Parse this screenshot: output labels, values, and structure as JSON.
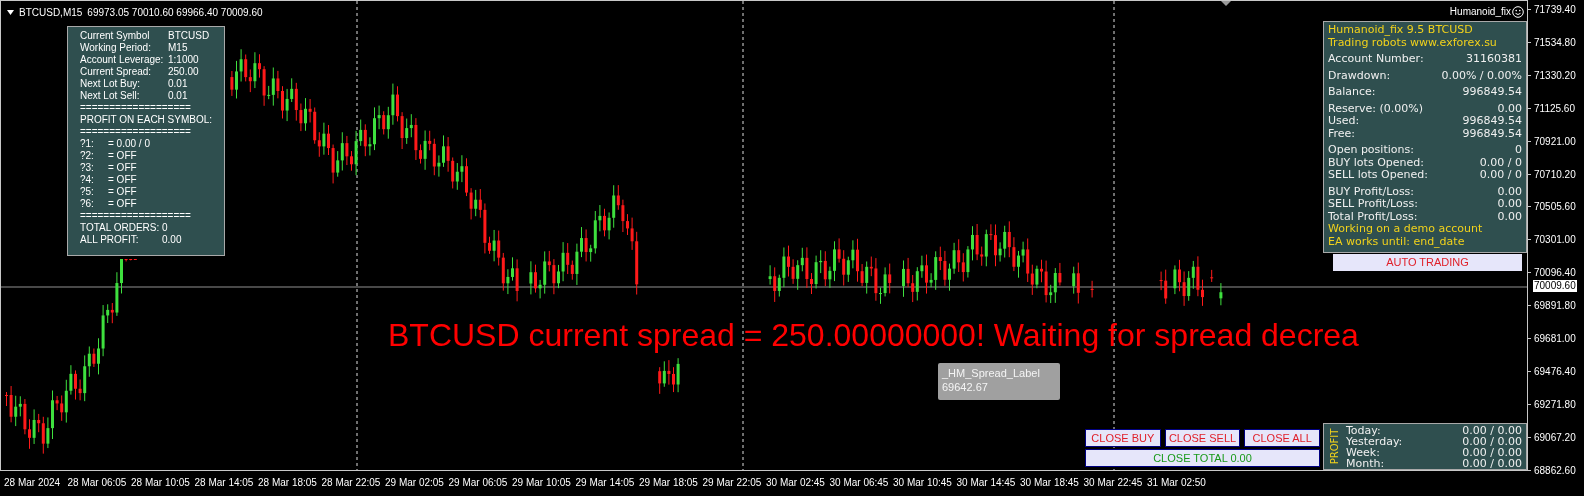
{
  "chart_header": {
    "symbol": "BTCUSD,M15",
    "prices": [
      "69973.05",
      "70010.60",
      "69966.40",
      "70009.60"
    ]
  },
  "expert_label": "Humanoid_fix",
  "info_panel": {
    "rows": [
      {
        "kind": "pair",
        "label": "Current Symbol",
        "value": "BTCUSD"
      },
      {
        "kind": "pair",
        "label": "Working Period:",
        "value": "M15"
      },
      {
        "kind": "pair",
        "label": "Account Leverage:",
        "value": "1:1000"
      },
      {
        "kind": "pair",
        "label": "Current Spread:",
        "value": "250.00"
      },
      {
        "kind": "pair",
        "label": "Next Lot Buy:",
        "value": "0.01"
      },
      {
        "kind": "pair",
        "label": "Next Lot Sell:",
        "value": "0.01"
      },
      {
        "kind": "text",
        "text": "==================="
      },
      {
        "kind": "text",
        "text": "PROFIT ON EACH SYMBOL:"
      },
      {
        "kind": "text",
        "text": "==================="
      },
      {
        "kind": "symbol",
        "label": "?1:",
        "value": "= 0.00 / 0"
      },
      {
        "kind": "symbol",
        "label": "?2:",
        "value": "= OFF"
      },
      {
        "kind": "symbol",
        "label": "?3:",
        "value": "= OFF"
      },
      {
        "kind": "symbol",
        "label": "?4:",
        "value": "= OFF"
      },
      {
        "kind": "symbol",
        "label": "?5:",
        "value": "= OFF"
      },
      {
        "kind": "symbol",
        "label": "?6:",
        "value": "= OFF"
      },
      {
        "kind": "text",
        "text": "==================="
      },
      {
        "kind": "total",
        "label": "TOTAL ORDERS:",
        "value": "0"
      },
      {
        "kind": "total_wide",
        "label": "ALL PROFIT:",
        "value": "0.00"
      }
    ]
  },
  "account_panel": {
    "sections": [
      [
        {
          "kind": "note",
          "text": "Humanoid_fix 9.5 BTCUSD"
        },
        {
          "kind": "note",
          "text": "Trading robots www.exforex.su"
        }
      ],
      [
        {
          "kind": "pair",
          "label": "Account Number:",
          "value": "31160381"
        }
      ],
      [
        {
          "kind": "pair",
          "label": "Drawdown:",
          "value": "0.00% / 0.00%"
        }
      ],
      [
        {
          "kind": "pair",
          "label": "Balance:",
          "value": "996849.54"
        }
      ],
      [
        {
          "kind": "pair",
          "label": "Reserve: (0.00%)",
          "value": "0.00"
        },
        {
          "kind": "pair",
          "label": "Used:",
          "value": "996849.54"
        },
        {
          "kind": "pair",
          "label": "Free:",
          "value": "996849.54"
        }
      ],
      [
        {
          "kind": "pair",
          "label": "Open positions:",
          "value": "0"
        },
        {
          "kind": "pair",
          "label": "BUY lots Opened:",
          "value": "0.00 / 0"
        },
        {
          "kind": "pair",
          "label": "SELL lots Opened:",
          "value": "0.00 / 0"
        }
      ],
      [
        {
          "kind": "pair",
          "label": "BUY Profit/Loss:",
          "value": "0.00"
        },
        {
          "kind": "pair",
          "label": "SELL Profit/Loss:",
          "value": "0.00"
        },
        {
          "kind": "pair",
          "label": "Total Profit/Loss:",
          "value": "0.00"
        },
        {
          "kind": "note",
          "text": "Working on a demo account"
        },
        {
          "kind": "note",
          "text": "EA works until: end_date"
        }
      ]
    ]
  },
  "auto_trading_button": "AUTO TRADING",
  "spread_message": "BTCUSD current spread = 250.00000000! Waiting for spread decrea",
  "tooltip": {
    "title": "_HM_Spread_Label",
    "value": "69642.67"
  },
  "close_buttons": [
    {
      "kind": "small",
      "label": "CLOSE BUY",
      "color": "#e0202a"
    },
    {
      "kind": "small",
      "label": "CLOSE SELL",
      "color": "#e0202a"
    },
    {
      "kind": "small",
      "label": "CLOSE ALL",
      "color": "#e0202a"
    },
    {
      "kind": "wide",
      "label": "CLOSE TOTAL 0.00",
      "color": "#1a9a1a"
    }
  ],
  "profit_panel": {
    "title": "PROFIT",
    "rows": [
      {
        "label": "Today:",
        "value": "0.00 / 0.00"
      },
      {
        "label": "Yesterday:",
        "value": "0.00 / 0.00"
      },
      {
        "label": "Week:",
        "value": "0.00 / 0.00"
      },
      {
        "label": "Month:",
        "value": "0.00 / 0.00"
      }
    ]
  },
  "price_axis": {
    "labels": [
      "71739.40",
      "71534.80",
      "71330.20",
      "71125.60",
      "70921.00",
      "70710.20",
      "70505.60",
      "70301.00",
      "70096.40",
      "69891.80",
      "69681.00",
      "69476.40",
      "69271.80",
      "69067.20",
      "68862.60"
    ],
    "current": "70009.60"
  },
  "time_axis": {
    "labels": [
      "28 Mar 2024",
      "28 Mar 06:05",
      "28 Mar 10:05",
      "28 Mar 14:05",
      "28 Mar 18:05",
      "28 Mar 22:05",
      "29 Mar 02:05",
      "29 Mar 06:05",
      "29 Mar 10:05",
      "29 Mar 14:05",
      "29 Mar 18:05",
      "29 Mar 22:05",
      "30 Mar 02:45",
      "30 Mar 06:45",
      "30 Mar 10:45",
      "30 Mar 14:45",
      "30 Mar 18:45",
      "30 Mar 22:45",
      "31 Mar 02:50"
    ]
  }
}
